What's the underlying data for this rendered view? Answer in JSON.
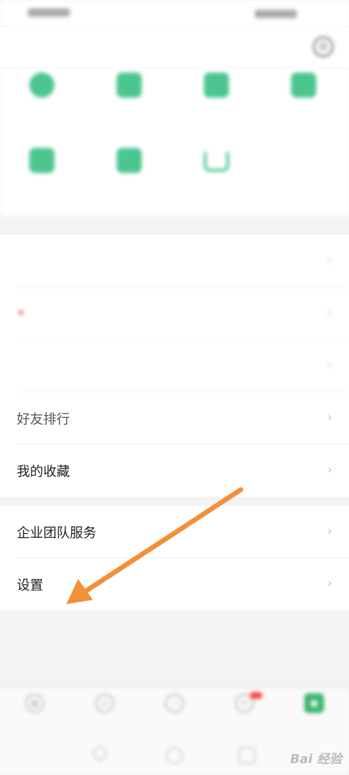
{
  "status_bar": {
    "left": "",
    "right": ""
  },
  "navbar": {
    "title": ""
  },
  "quick_grid": [
    {
      "label": "",
      "icon": "diamond-icon"
    },
    {
      "label": "",
      "icon": "shirt-icon"
    },
    {
      "label": "",
      "icon": "calendar-icon"
    },
    {
      "label": "",
      "icon": "message-icon"
    },
    {
      "label": "",
      "icon": "coupon-icon"
    },
    {
      "label": "",
      "icon": "order-icon"
    },
    {
      "label": "",
      "icon": "cart-icon"
    }
  ],
  "menu_section_1": [
    {
      "label": ""
    },
    {
      "label": "",
      "has_red_dot": true
    },
    {
      "label": ""
    },
    {
      "label": "好友排行"
    },
    {
      "label": "我的收藏"
    }
  ],
  "menu_section_2": [
    {
      "label": "企业团队服务"
    },
    {
      "label": "设置"
    }
  ],
  "tabbar": {
    "items": [
      {
        "label": "",
        "icon": "record-icon"
      },
      {
        "label": "",
        "icon": "compass-icon"
      },
      {
        "label": "",
        "icon": "search-icon"
      },
      {
        "label": "",
        "icon": "message-icon",
        "has_badge": true
      },
      {
        "label": "",
        "icon": "profile-icon",
        "active": true
      }
    ]
  },
  "watermark": {
    "text": "Bai 经验"
  },
  "colors": {
    "accent_green": "#4cc590",
    "active_tab_green": "#35b36a",
    "badge_red": "#f04a4a",
    "annotation_orange": "#f3903a"
  },
  "icons": {
    "chevron": "chevron-right-icon",
    "settings": "gear-icon"
  }
}
